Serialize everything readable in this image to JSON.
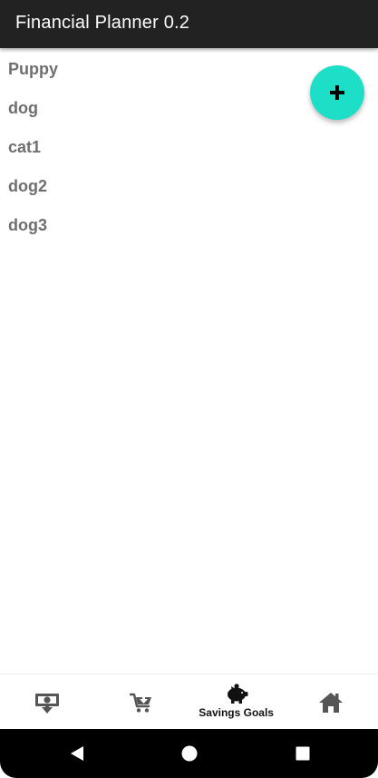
{
  "app_bar": {
    "title": "Financial Planner 0.2"
  },
  "goals": [
    {
      "name": "Puppy"
    },
    {
      "name": "dog"
    },
    {
      "name": "cat1"
    },
    {
      "name": "dog2"
    },
    {
      "name": "dog3"
    }
  ],
  "fab": {
    "icon": "plus-icon",
    "color": "#1ddfc7"
  },
  "bottom_nav": {
    "items": [
      {
        "icon": "money-download-icon",
        "label": ""
      },
      {
        "icon": "shopping-cart-icon",
        "label": ""
      },
      {
        "icon": "piggy-bank-icon",
        "label": "Savings Goals",
        "active": true
      },
      {
        "icon": "home-icon",
        "label": ""
      }
    ]
  },
  "system_nav": {
    "buttons": [
      "back-icon",
      "home-circle-icon",
      "recents-icon"
    ]
  },
  "colors": {
    "app_bar": "#222222",
    "list_text": "#6f6f6f",
    "accent": "#1ddfc7"
  }
}
